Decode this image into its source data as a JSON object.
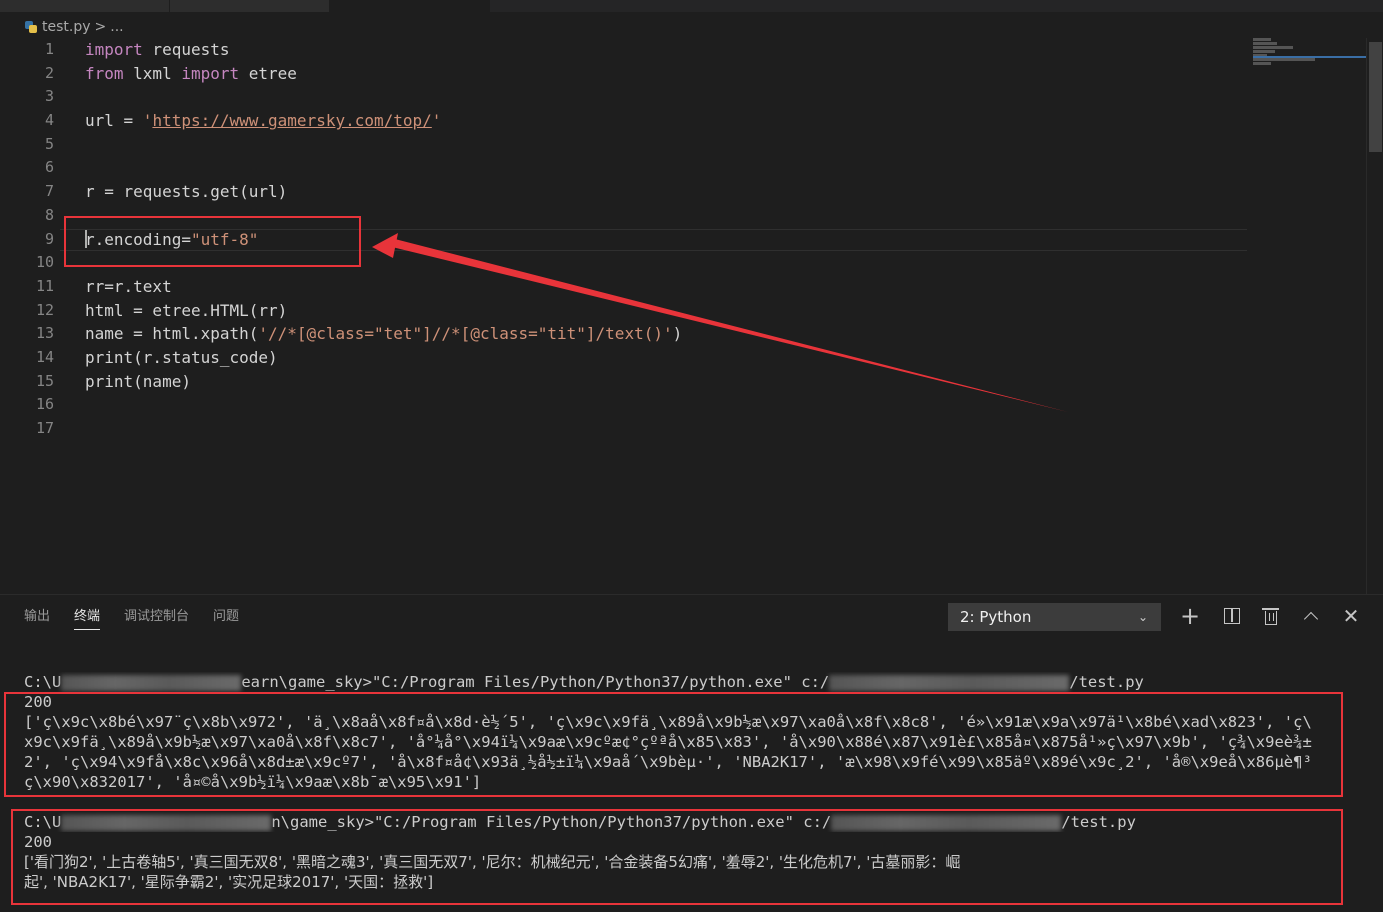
{
  "breadcrumb": {
    "file": "test.py",
    "sep": ">",
    "rest": "..."
  },
  "editor": {
    "line_numbers": [
      "1",
      "2",
      "3",
      "4",
      "5",
      "6",
      "7",
      "8",
      "9",
      "10",
      "11",
      "12",
      "13",
      "14",
      "15",
      "16",
      "17"
    ],
    "lines": {
      "l1": {
        "kw": "import",
        "rest": " requests"
      },
      "l2": {
        "kw1": "from",
        "mid": " lxml ",
        "kw2": "import",
        "rest": " etree"
      },
      "l4": {
        "pre": "url = ",
        "q1": "'",
        "url": "https://www.gamersky.com/top/",
        "q2": "'"
      },
      "l7": {
        "text": "r = requests.get(url)"
      },
      "l9": {
        "pre": "r.encoding=",
        "str": "\"utf-8\""
      },
      "l11": {
        "text": "rr=r.text"
      },
      "l12": {
        "text": "html = etree.HTML(rr)"
      },
      "l13": {
        "pre": "name = html.xpath(",
        "str": "'//*[@class=\"tet\"]//*[@class=\"tit\"]/text()'",
        "post": ")"
      },
      "l14": {
        "text": "print(r.status_code)"
      },
      "l15": {
        "text": "print(name)"
      }
    }
  },
  "panel": {
    "tabs": [
      "输出",
      "终端",
      "调试控制台",
      "问题"
    ],
    "active_tab": "终端",
    "terminal_select": "2: Python",
    "icons": [
      "plus-icon",
      "split-icon",
      "trash-icon",
      "chevron-up-icon",
      "close-icon"
    ]
  },
  "terminal": {
    "run1": {
      "prompt_a": "C:\\U",
      "prompt_b": "earn\\game_sky>\"C:/Program Files/Python/Python37/python.exe\" c:/",
      "prompt_c": "/test.py",
      "status": "200",
      "out1": "['ç\\x9c\\x8bé\\x97¨ç\\x8b\\x972', 'ä¸\\x8aå\\x8f¤å\\x8d·è½´5', 'ç\\x9c\\x9fä¸\\x89å\\x9b½æ\\x97\\xa0å\\x8f\\x8c8', 'é»\\x91æ\\x9a\\x97ä¹\\x8bé\\xad\\x823', 'ç\\",
      "out2": "x9c\\x9fä¸\\x89å\\x9b½æ\\x97\\xa0å\\x8f\\x8c7', 'å°¼å°\\x94ï¼\\x9aæ\\x9cºæ¢°çºªå\\x85\\x83', 'å\\x90\\x88é\\x87\\x91è£\\x85å¤\\x875å¹»ç\\x97\\x9b', 'ç¾\\x9eè¾±",
      "out3": "2', 'ç\\x94\\x9få\\x8c\\x96å\\x8d±æ\\x9cº7', 'å\\x8f¤å¢\\x93ä¸½å½±ï¼\\x9aå´\\x9bèµ·', 'NBA2K17', 'æ\\x98\\x9fé\\x99\\x85äº\\x89é\\x9c¸2', 'å®\\x9eå\\x86µè¶³",
      "out4": "ç\\x90\\x832017', 'å¤©å\\x9b½ï¼\\x9aæ\\x8b¯æ\\x95\\x91']"
    },
    "run2": {
      "prompt_a": "C:\\U",
      "prompt_b": "n\\game_sky>\"C:/Program Files/Python/Python37/python.exe\" c:/",
      "prompt_c": "/test.py",
      "status": "200",
      "out1": "['看门狗2', '上古卷轴5', '真三国无双8', '黑暗之魂3', '真三国无双7', '尼尔：机械纪元', '合金装备5幻痛', '羞辱2', '生化危机7', '古墓丽影：崛",
      "out2": "起', 'NBA2K17', '星际争霸2', '实况足球2017', '天国：拯救']"
    }
  },
  "colors": {
    "annotation": "#e8343a",
    "keyword": "#c586c0",
    "string": "#ce9178"
  }
}
